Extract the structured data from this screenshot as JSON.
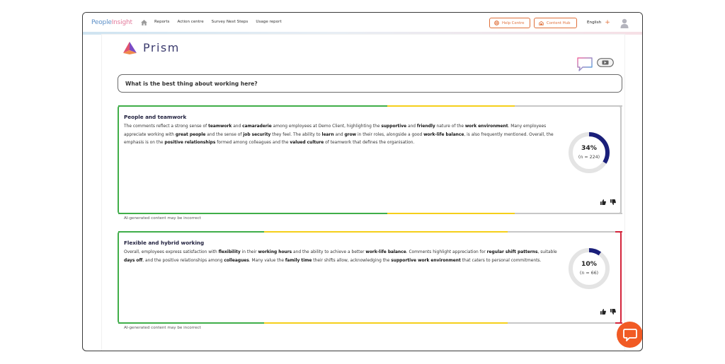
{
  "topbar": {
    "brand": {
      "primary": "People",
      "accent": "Insight"
    },
    "nav": [
      "Reports",
      "Action centre",
      "Survey Next Steps",
      "Usage report"
    ],
    "help_label": "Help Centre",
    "hub_label": "Content Hub",
    "language": "English",
    "language_add": "+"
  },
  "prism": {
    "brand": "Prism",
    "question": "What is the best thing about working here?"
  },
  "colors": {
    "green": "#3fae49",
    "yellow": "#f5cf1a",
    "grey": "#c7c7c7",
    "red": "#d4243b",
    "navy": "#1a1f7a",
    "accent": "#f15a24"
  },
  "cards": [
    {
      "title": "People and teamwork",
      "percent_label": "34%",
      "percent": 34,
      "n_label": "(n = 224)",
      "ai_note": "AI-generated content may be incorrect",
      "body": [
        {
          "t": "The comments reflect a strong sense of "
        },
        {
          "b": "teamwork"
        },
        {
          "t": " and "
        },
        {
          "b": "camaraderie"
        },
        {
          "t": " among employees at Demo Client, highlighting the "
        },
        {
          "b": "supportive"
        },
        {
          "t": " and "
        },
        {
          "b": "friendly"
        },
        {
          "t": " nature of the "
        },
        {
          "b": "work environment"
        },
        {
          "t": ". Many employees appreciate working with "
        },
        {
          "b": "great people"
        },
        {
          "t": " and the sense of "
        },
        {
          "b": "job security"
        },
        {
          "t": " they feel. The ability to "
        },
        {
          "b": "learn"
        },
        {
          "t": " and "
        },
        {
          "b": "grow"
        },
        {
          "t": " in their roles, alongside a good "
        },
        {
          "b": "work-life balance"
        },
        {
          "t": ", is also frequently mentioned. Overall, the emphasis is on the "
        },
        {
          "b": "positive relationships"
        },
        {
          "t": " formed among colleagues and the "
        },
        {
          "b": "valued culture"
        },
        {
          "t": " of teamwork that defines the organisation."
        }
      ]
    },
    {
      "title": "Flexible and hybrid working",
      "percent_label": "10%",
      "percent": 10,
      "n_label": "(n = 66)",
      "ai_note": "AI-generated content may be incorrect",
      "body": [
        {
          "t": "Overall, employees express satisfaction with "
        },
        {
          "b": "flexibility"
        },
        {
          "t": " in their "
        },
        {
          "b": "working hours"
        },
        {
          "t": " and the ability to achieve a better "
        },
        {
          "b": "work-life balance"
        },
        {
          "t": ". Comments highlight appreciation for "
        },
        {
          "b": "regular shift patterns"
        },
        {
          "t": ", suitable "
        },
        {
          "b": "days off"
        },
        {
          "t": ", and the positive relationships among "
        },
        {
          "b": "colleagues"
        },
        {
          "t": ". Many value the "
        },
        {
          "b": "family time"
        },
        {
          "t": " their shifts allow, acknowledging the "
        },
        {
          "b": "supportive work environment"
        },
        {
          "t": " that caters to personal commitments."
        }
      ]
    }
  ]
}
